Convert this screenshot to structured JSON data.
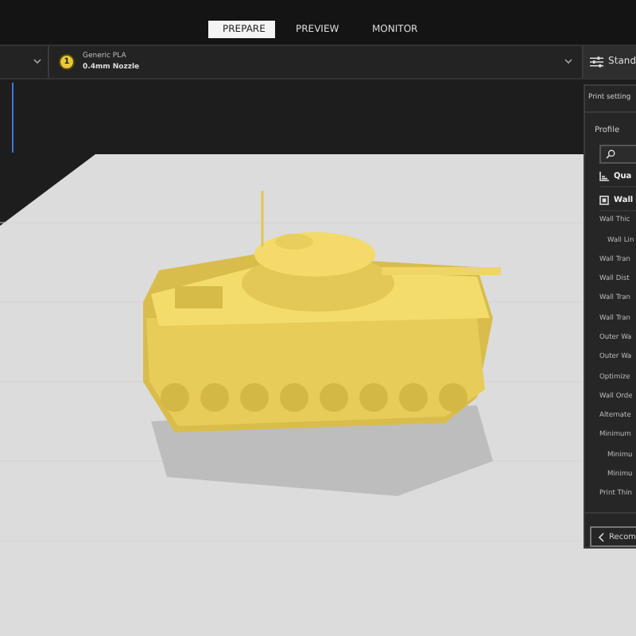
{
  "tabs": [
    {
      "label": "PREPARE",
      "selected": true
    },
    {
      "label": "PREVIEW",
      "selected": false
    },
    {
      "label": "MONITOR",
      "selected": false
    }
  ],
  "extruder": {
    "number": "1",
    "material": "Generic PLA",
    "nozzle": "0.4mm Nozzle"
  },
  "settings_button": {
    "label": "Stand"
  },
  "panel": {
    "title": "Print setting",
    "profile_label": "Profile",
    "sections": [
      {
        "label": "Qua",
        "kind": "quality"
      },
      {
        "label": "Wall",
        "kind": "wall"
      }
    ],
    "settings": [
      {
        "label": "Wall Thic",
        "children": [
          {
            "label": "Wall Lin"
          }
        ]
      },
      {
        "label": "Wall Tran"
      },
      {
        "label": "Wall Dist"
      },
      {
        "label": "Wall Tran"
      },
      {
        "label": "Wall Tran"
      },
      {
        "label": "Outer Wa"
      },
      {
        "label": "Outer Wa"
      },
      {
        "label": "Optimize"
      },
      {
        "label": "Wall Orde"
      },
      {
        "label": "Alternate"
      },
      {
        "label": "Minimum",
        "children": [
          {
            "label": "Minimu"
          },
          {
            "label": "Minimu"
          }
        ]
      },
      {
        "label": "Print Thin"
      }
    ],
    "recommended_button": "Recom"
  }
}
